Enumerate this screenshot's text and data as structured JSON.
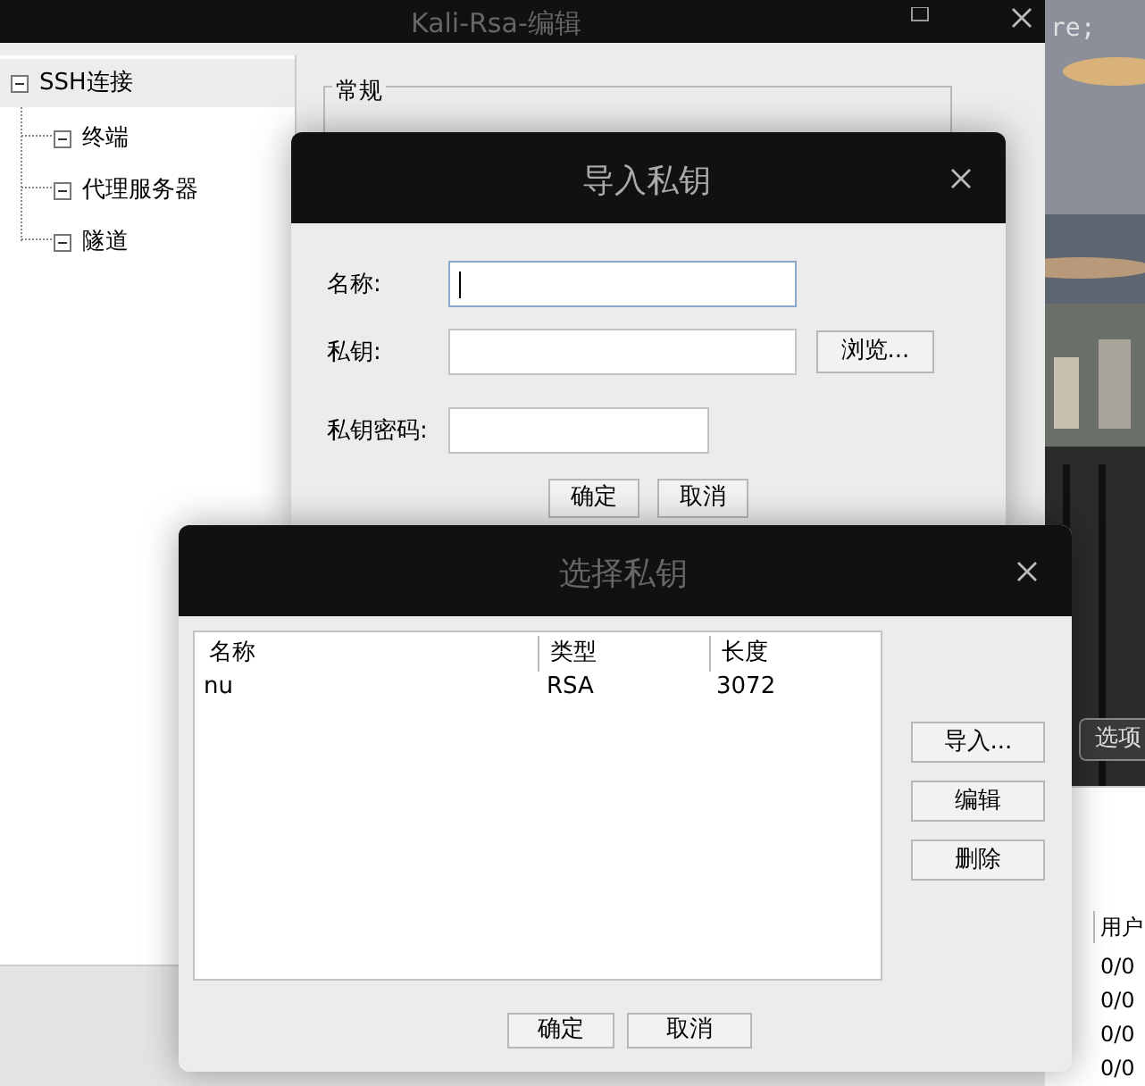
{
  "desktop": {
    "corner_text": "re;",
    "options_button": "选项"
  },
  "editor_window": {
    "title": "Kali-Rsa-编辑",
    "tree": [
      {
        "label": "SSH连接",
        "selected": true,
        "children": [
          {
            "label": "终端",
            "selected": false
          },
          {
            "label": "代理服务器",
            "selected": false
          },
          {
            "label": "隧道",
            "selected": false
          }
        ]
      }
    ],
    "group_title": "常规"
  },
  "file_list": {
    "column": "用户",
    "rows": [
      "0/0",
      "0/0",
      "0/0",
      "0/0"
    ]
  },
  "import_dialog": {
    "title": "导入私钥",
    "fields": [
      {
        "label": "名称:",
        "focused": true
      },
      {
        "label": "私钥:",
        "focused": false,
        "button": "浏览..."
      },
      {
        "label": "私钥密码:",
        "focused": false
      }
    ],
    "buttons": [
      "确定",
      "取消"
    ]
  },
  "select_dialog": {
    "title": "选择私钥",
    "columns": [
      "名称",
      "类型",
      "长度"
    ],
    "rows": [
      [
        "nu",
        "RSA",
        "3072"
      ]
    ],
    "side_buttons": [
      "导入...",
      "编辑",
      "删除"
    ],
    "buttons": [
      "确定",
      "取消"
    ]
  }
}
